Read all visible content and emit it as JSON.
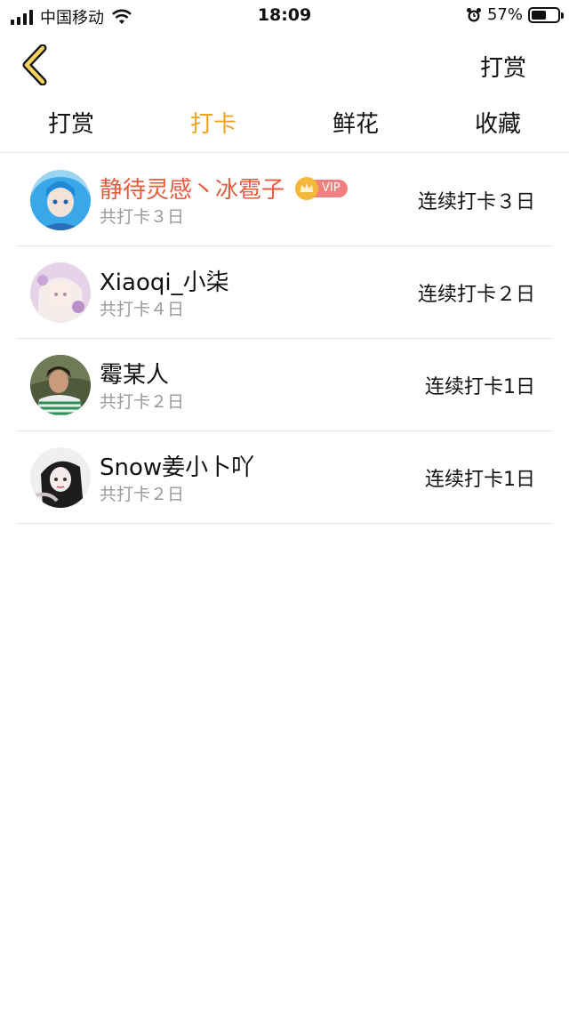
{
  "status_bar": {
    "carrier": "中国移动",
    "time": "18:09",
    "battery_pct": "57%",
    "battery_level": 0.57
  },
  "nav": {
    "back_icon": "chevron-left-icon",
    "right_action": "打赏"
  },
  "tabs": [
    {
      "label": "打赏",
      "active": false
    },
    {
      "label": "打卡",
      "active": true
    },
    {
      "label": "鲜花",
      "active": false
    },
    {
      "label": "收藏",
      "active": false
    }
  ],
  "colors": {
    "accent": "#f0a321",
    "vip_name": "#e85b3c",
    "vip_tag": "#f07f7f",
    "crown": "#f3b73a"
  },
  "checkins": [
    {
      "name": "静待灵感丶冰雹子",
      "vip": true,
      "vip_label": "VIP",
      "total": "共打卡３日",
      "streak": "连续打卡３日"
    },
    {
      "name": "Xiaoqi_小柒",
      "vip": false,
      "total": "共打卡４日",
      "streak": "连续打卡２日"
    },
    {
      "name": "霉某人",
      "vip": false,
      "total": "共打卡２日",
      "streak": "连续打卡1日"
    },
    {
      "name": "Snow姜小卜吖",
      "vip": false,
      "total": "共打卡２日",
      "streak": "连续打卡1日"
    }
  ]
}
